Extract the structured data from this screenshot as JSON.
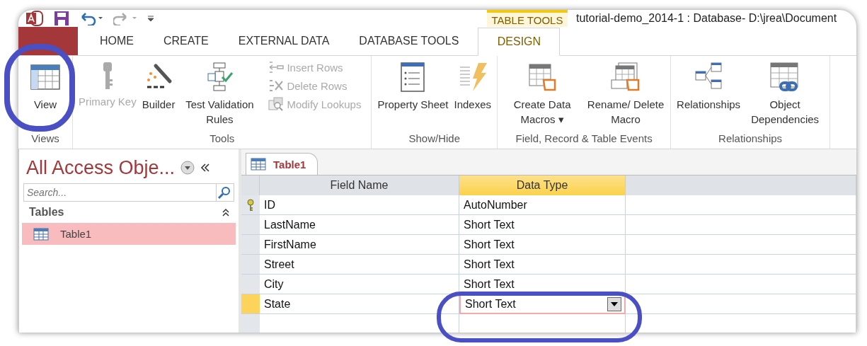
{
  "title_bar": {
    "contextual_label": "TABLE TOOLS",
    "title": "tutorial-demo_2014-1 : Database- D:\\jrea\\Document"
  },
  "tabs": [
    {
      "kind": "file",
      "selected": false
    },
    {
      "label": "HOME",
      "kind": "normal",
      "selected": false
    },
    {
      "label": "CREATE",
      "kind": "normal",
      "selected": false
    },
    {
      "label": "EXTERNAL DATA",
      "kind": "normal",
      "selected": false
    },
    {
      "label": "DATABASE TOOLS",
      "kind": "normal",
      "selected": false
    },
    {
      "label": "DESIGN",
      "kind": "contextual",
      "selected": true
    }
  ],
  "ribbon": [
    {
      "label": "Views",
      "buttons": [
        {
          "kind": "large",
          "label": "View",
          "disabled": false
        }
      ]
    },
    {
      "label": "Tools",
      "buttons": [
        {
          "kind": "large",
          "label": "Primary Key",
          "disabled": true
        },
        {
          "kind": "large",
          "label": "Builder",
          "disabled": false
        },
        {
          "kind": "large",
          "label": "Test Validation Rules",
          "disabled": false
        },
        {
          "kind": "small",
          "label": "Insert Rows",
          "disabled": true
        },
        {
          "kind": "small",
          "label": "Delete Rows",
          "disabled": true
        },
        {
          "kind": "small",
          "label": "Modify Lookups",
          "disabled": true
        }
      ]
    },
    {
      "label": "Show/Hide",
      "buttons": [
        {
          "kind": "large",
          "label": "Property Sheet",
          "disabled": false
        },
        {
          "kind": "large",
          "label": "Indexes",
          "disabled": false
        }
      ]
    },
    {
      "label": "Field, Record & Table Events",
      "buttons": [
        {
          "kind": "large",
          "label": "Create Data Macros ▾",
          "disabled": false
        },
        {
          "kind": "large",
          "label": "Rename/ Delete Macro",
          "disabled": false
        }
      ]
    },
    {
      "label": "Relationships",
      "buttons": [
        {
          "kind": "large",
          "label": "Relationships",
          "disabled": false
        },
        {
          "kind": "large",
          "label": "Object Dependencies",
          "disabled": false
        }
      ]
    }
  ],
  "nav_pane": {
    "title": "All Access Obje...",
    "search": {
      "placeholder": "Search..."
    },
    "group": "Tables",
    "items": [
      {
        "label": "Table1",
        "selected": true
      }
    ]
  },
  "document_tab": "Table1",
  "table": {
    "columns": [
      {
        "label": "Field Name",
        "selected": false
      },
      {
        "label": "Data Type",
        "selected": true
      }
    ],
    "rows": [
      {
        "field_name": "ID",
        "data_type": "AutoNumber",
        "primary_key": true,
        "selected": false
      },
      {
        "field_name": "LastName",
        "data_type": "Short Text",
        "primary_key": false,
        "selected": false
      },
      {
        "field_name": "FirstName",
        "data_type": "Short Text",
        "primary_key": false,
        "selected": false
      },
      {
        "field_name": "Street",
        "data_type": "Short Text",
        "primary_key": false,
        "selected": false
      },
      {
        "field_name": "City",
        "data_type": "Short Text",
        "primary_key": false,
        "selected": false
      },
      {
        "field_name": "State",
        "data_type": "Short Text",
        "primary_key": false,
        "selected": true
      }
    ]
  }
}
